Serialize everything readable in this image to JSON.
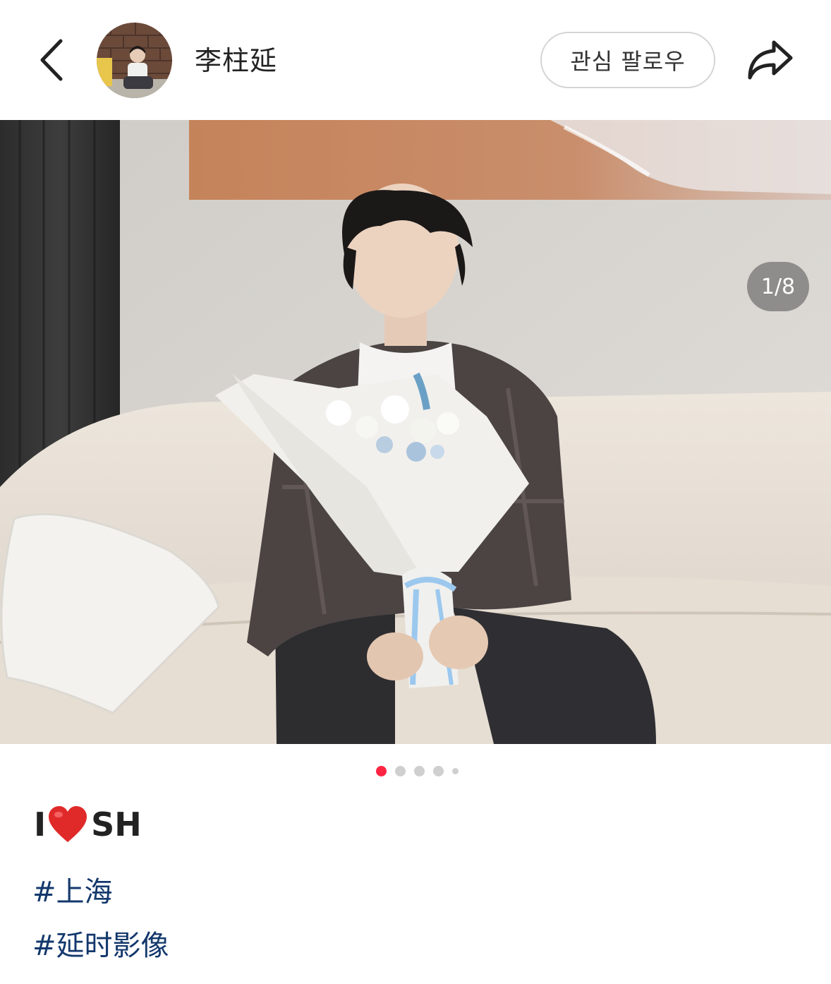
{
  "header": {
    "username": "李柱延",
    "follow_label": "관심 팔로우"
  },
  "media": {
    "counter": "1/8",
    "dot_count": 5,
    "active_dot": 0
  },
  "caption": {
    "text_before": "I",
    "emoji": "heart-emoji",
    "text_after": "SH",
    "tags": [
      "#上海",
      "#延时影像"
    ]
  },
  "colors": {
    "accent": "#ff2442",
    "tag": "#13386c"
  }
}
